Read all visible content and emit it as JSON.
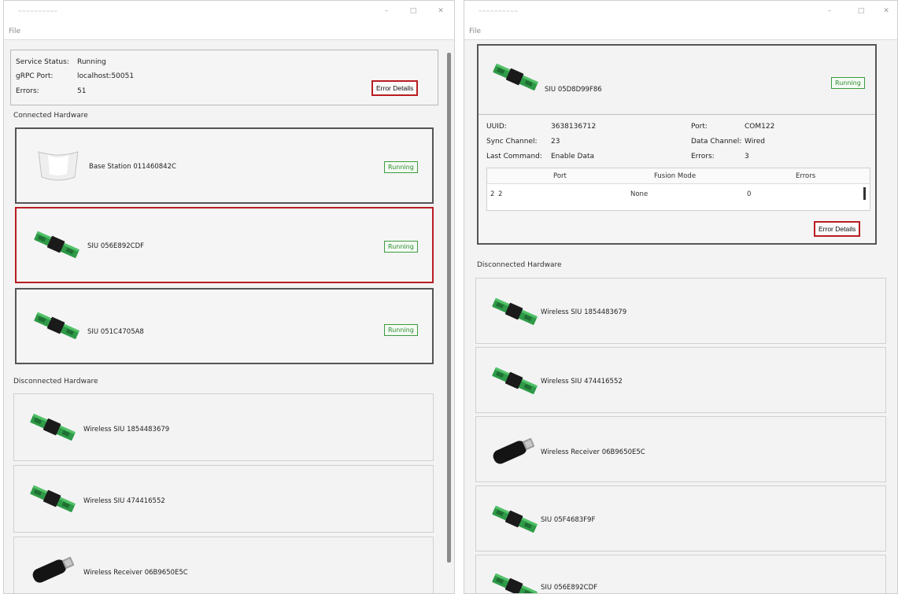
{
  "left": {
    "menu_file": "File",
    "status": {
      "service_status_label": "Service Status:",
      "service_status_value": "Running",
      "grpc_port_label": "gRPC Port:",
      "grpc_port_value": "localhost:50051",
      "errors_label": "Errors:",
      "errors_value": "51",
      "error_details": "Error Details"
    },
    "connected_title": "Connected Hardware",
    "connected": [
      {
        "name": "Base Station  011460842C",
        "status": "Running"
      },
      {
        "name": "SIU  056E892CDF",
        "status": "Running"
      },
      {
        "name": "SIU  051C4705A8",
        "status": "Running"
      }
    ],
    "disconnected_title": "Disconnected Hardware",
    "disconnected": [
      {
        "name": "Wireless SIU  1854483679"
      },
      {
        "name": "Wireless SIU  474416552"
      },
      {
        "name": "Wireless Receiver  06B9650E5C"
      }
    ]
  },
  "right": {
    "menu_file": "File",
    "device": {
      "name": "SIU  05D8D99F86",
      "status": "Running",
      "uuid_label": "UUID:",
      "uuid_value": "3638136712",
      "sync_label": "Sync Channel:",
      "sync_value": "23",
      "last_cmd_label": "Last Command:",
      "last_cmd_value": "Enable Data",
      "port_label": "Port:",
      "port_value": "COM122",
      "data_channel_label": "Data Channel:",
      "data_channel_value": "Wired",
      "errors_label": "Errors:",
      "errors_value": "3",
      "table": {
        "headers": [
          "Port",
          "Fusion Mode",
          "Errors"
        ],
        "row": {
          "index": "2",
          "port": "2",
          "fusion": "None",
          "errors": "0"
        }
      },
      "error_details": "Error Details"
    },
    "disconnected_title": "Disconnected Hardware",
    "disconnected": [
      {
        "name": "Wireless SIU  1854483679"
      },
      {
        "name": "Wireless SIU  474416552"
      },
      {
        "name": "Wireless Receiver  06B9650E5C"
      },
      {
        "name": "SIU  05F4683F9F"
      },
      {
        "name": "SIU  056E892CDF"
      }
    ]
  }
}
